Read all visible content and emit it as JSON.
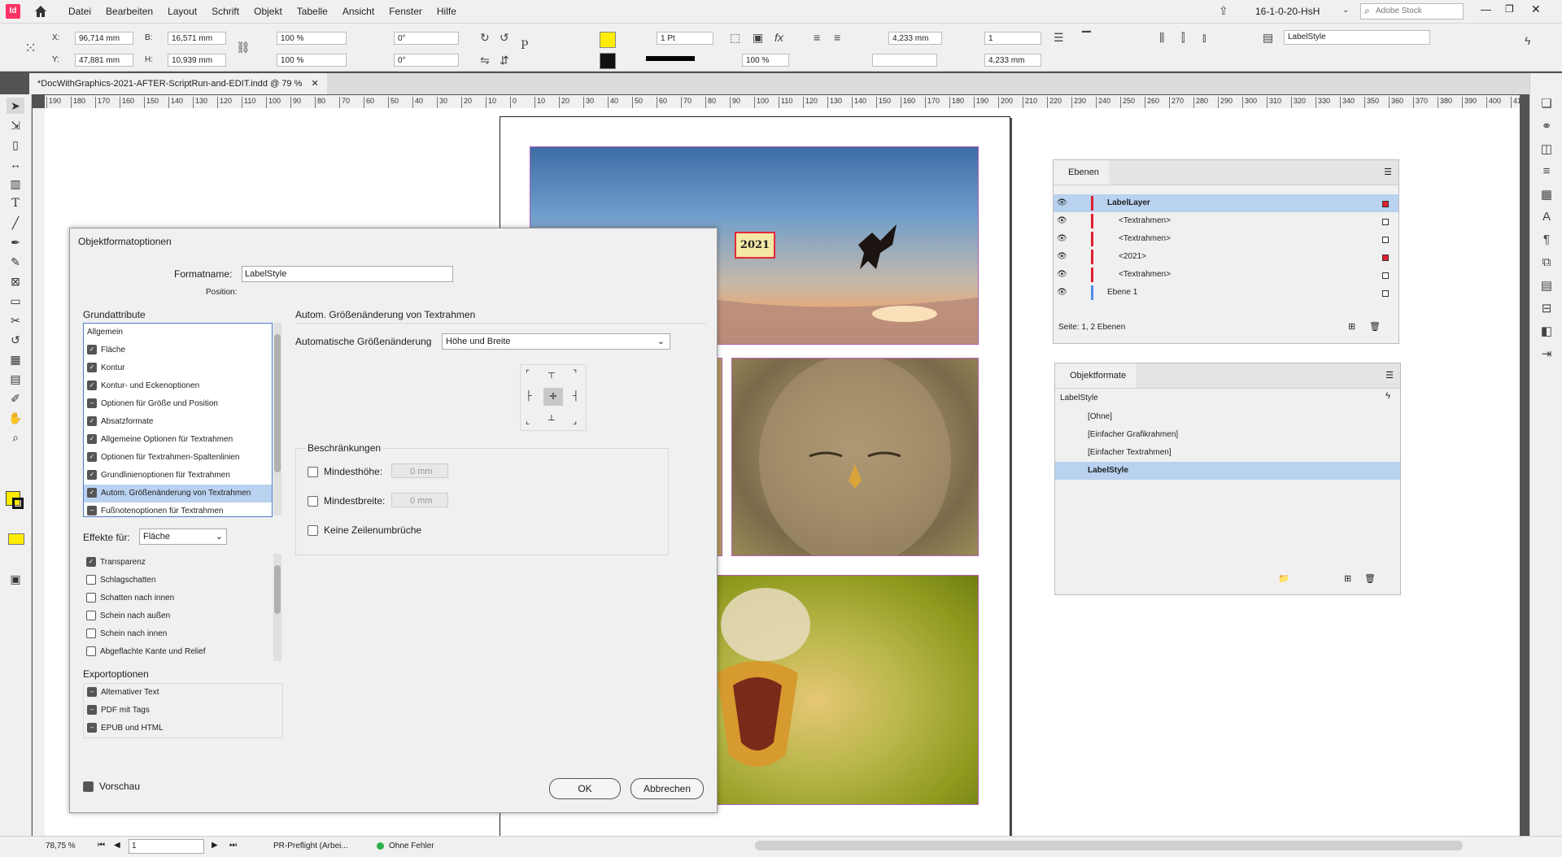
{
  "app": {
    "logo": "Id",
    "menu": [
      "Datei",
      "Bearbeiten",
      "Layout",
      "Schrift",
      "Objekt",
      "Tabelle",
      "Ansicht",
      "Fenster",
      "Hilfe"
    ],
    "workspace": "16-1-0-20-HsH",
    "search_placeholder": "Adobe Stock"
  },
  "control": {
    "x_label": "X:",
    "x": "96,714 mm",
    "y_label": "Y:",
    "y": "47,881 mm",
    "b_label": "B:",
    "b": "16,571 mm",
    "h_label": "H:",
    "h": "10,939 mm",
    "scale_x": "100 %",
    "scale_y": "100 %",
    "angle": "0°",
    "shear": "0°",
    "stroke_weight": "1 Pt",
    "opacity": "100 %",
    "inset1": "4,233 mm",
    "inset2": "4,233 mm",
    "columns": "1",
    "object_style": "LabelStyle"
  },
  "document": {
    "tab_title": "*DocWithGraphics-2021-AFTER-ScriptRun-and-EDIT.indd @ 79 %",
    "ruler_labels": [
      "190",
      "180",
      "170",
      "160",
      "150",
      "140",
      "130",
      "120",
      "110",
      "100",
      "90",
      "80",
      "70",
      "60",
      "50",
      "40",
      "30",
      "20",
      "10",
      "0",
      "10",
      "20",
      "30",
      "40",
      "50",
      "60",
      "70",
      "80",
      "90",
      "100",
      "110",
      "120",
      "130",
      "140",
      "150",
      "160",
      "170",
      "180",
      "190",
      "200",
      "210",
      "220",
      "230",
      "240",
      "250",
      "260",
      "270",
      "280",
      "290",
      "300",
      "310",
      "320",
      "330",
      "340",
      "350",
      "360",
      "370",
      "380",
      "390",
      "400",
      "410"
    ],
    "label_text": "2021"
  },
  "dialog": {
    "title": "Objektformatoptionen",
    "formatname_label": "Formatname:",
    "formatname": "LabelStyle",
    "position_label": "Position:",
    "grundattribute_label": "Grundattribute",
    "grundattribute": [
      {
        "label": "Allgemein",
        "check": false,
        "nocb": true
      },
      {
        "label": "Fläche",
        "check": true
      },
      {
        "label": "Kontur",
        "check": true
      },
      {
        "label": "Kontur- und Eckenoptionen",
        "check": true
      },
      {
        "label": "Optionen für Größe und Position",
        "check": "partial"
      },
      {
        "label": "Absatzformate",
        "check": true
      },
      {
        "label": "Allgemeine Optionen für Textrahmen",
        "check": true
      },
      {
        "label": "Optionen für Textrahmen-Spaltenlinien",
        "check": true
      },
      {
        "label": "Grundlinienoptionen für Textrahmen",
        "check": true
      },
      {
        "label": "Autom. Größenänderung von Textrahmen",
        "check": true,
        "sel": true
      },
      {
        "label": "Fußnotenoptionen für Textrahmen",
        "check": "partial"
      }
    ],
    "effekte_label": "Effekte für:",
    "effekte_value": "Fläche",
    "effekte": [
      {
        "label": "Transparenz",
        "check": true
      },
      {
        "label": "Schlagschatten",
        "check": false
      },
      {
        "label": "Schatten nach innen",
        "check": false
      },
      {
        "label": "Schein nach außen",
        "check": false
      },
      {
        "label": "Schein nach innen",
        "check": false
      },
      {
        "label": "Abgeflachte Kante und Relief",
        "check": false
      }
    ],
    "export_label": "Exportoptionen",
    "export": [
      {
        "label": "Alternativer Text"
      },
      {
        "label": "PDF mit Tags"
      },
      {
        "label": "EPUB und HTML"
      }
    ],
    "section_title": "Autom. Größenänderung von Textrahmen",
    "auto_label": "Automatische Größenänderung",
    "auto_value": "Höhe und Breite",
    "constraints_label": "Beschränkungen",
    "min_height_label": "Mindesthöhe:",
    "min_height": "0 mm",
    "min_width_label": "Mindestbreite:",
    "min_width": "0 mm",
    "no_breaks_label": "Keine Zeilenumbrüche",
    "preview_label": "Vorschau",
    "ok": "OK",
    "cancel": "Abbrechen"
  },
  "layers_panel": {
    "title": "Ebenen",
    "rows": [
      {
        "label": "LabelLayer",
        "bold": true,
        "sel": true,
        "indent": 0
      },
      {
        "label": "<Textrahmen>",
        "indent": 1
      },
      {
        "label": "<Textrahmen>",
        "indent": 1
      },
      {
        "label": "<2021>",
        "indent": 1
      },
      {
        "label": "<Textrahmen>",
        "indent": 1
      },
      {
        "label": "Ebene 1",
        "indent": 0
      }
    ],
    "footer": "Seite: 1, 2 Ebenen"
  },
  "styles_panel": {
    "title": "Objektformate",
    "current": "LabelStyle",
    "rows": [
      {
        "label": "[Ohne]"
      },
      {
        "label": "[Einfacher Grafikrahmen]"
      },
      {
        "label": "[Einfacher Textrahmen]"
      },
      {
        "label": "LabelStyle",
        "sel": true
      }
    ]
  },
  "status": {
    "zoom": "78,75 %",
    "page": "1",
    "preflight": "PR-Preflight (Arbei...",
    "errors": "Ohne Fehler"
  }
}
